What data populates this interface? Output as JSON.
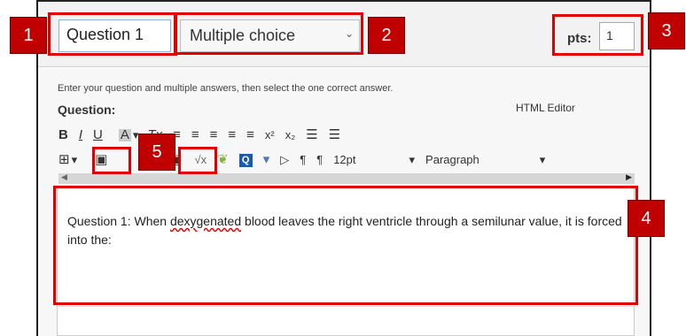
{
  "header": {
    "title_value": "Question 1",
    "type_value": "Multiple choice",
    "pts_label": "pts:",
    "pts_value": "1"
  },
  "editor_panel": {
    "instructions": "Enter your question and multiple answers, then select the one correct answer.",
    "question_label": "Question:",
    "html_editor_link": "HTML Editor",
    "toolbar_row1": [
      {
        "name": "bold-button",
        "glyph": "B"
      },
      {
        "name": "italic-button",
        "glyph": "I"
      },
      {
        "name": "underline-button",
        "glyph": "U"
      },
      {
        "name": "text-color-button",
        "glyph": "A"
      },
      {
        "name": "background-color-button",
        "glyph": "A"
      },
      {
        "name": "clear-formatting-button",
        "glyph": "Tx"
      },
      {
        "name": "align-left-button",
        "glyph": "≡"
      },
      {
        "name": "align-center-button",
        "glyph": "≡"
      },
      {
        "name": "align-right-button",
        "glyph": "≡"
      },
      {
        "name": "outdent-button",
        "glyph": "≡"
      },
      {
        "name": "indent-button",
        "glyph": "≡"
      },
      {
        "name": "superscript-button",
        "glyph": "x²"
      },
      {
        "name": "subscript-button",
        "glyph": "x₂"
      },
      {
        "name": "bullet-list-button",
        "glyph": "☰"
      },
      {
        "name": "numbered-list-button",
        "glyph": "☰"
      }
    ],
    "toolbar_row2": {
      "table_glyph": "⊞",
      "media_glyph": "▣",
      "image_glyph": "▣",
      "math_glyph": "√x",
      "font_size": "12pt",
      "paragraph": "Paragraph"
    },
    "question_text_before": "Question 1: When ",
    "question_text_misspelled": "dexygenated",
    "question_text_after": " blood leaves the right ventricle through a semilunar value, it is forced into the:"
  },
  "callouts": {
    "labels": [
      "1",
      "2",
      "3",
      "4",
      "5"
    ],
    "highlight_color": "#e00000",
    "badge_color": "#c00000"
  }
}
